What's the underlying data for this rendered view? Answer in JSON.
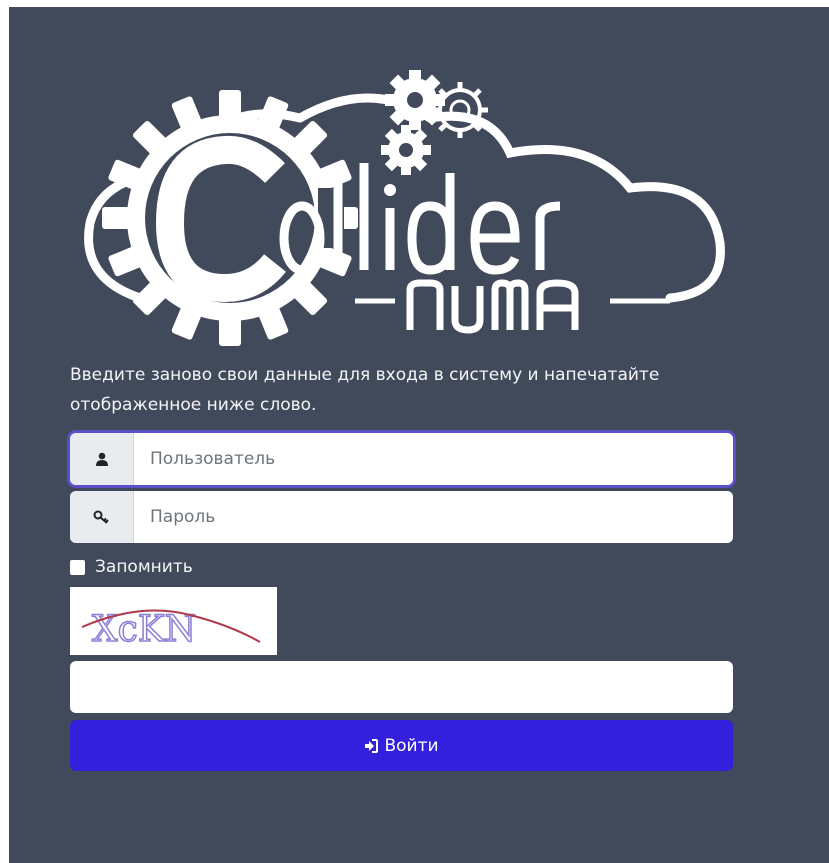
{
  "logo": {
    "brand_text": "Collider",
    "sub_text": "NUMA"
  },
  "intro": {
    "text": "Введите заново свои данные для входа в систему и напечатайте отображенное ниже слово."
  },
  "form": {
    "username": {
      "icon": "user-icon",
      "placeholder": "Пользователь",
      "value": ""
    },
    "password": {
      "icon": "key-icon",
      "placeholder": "Пароль",
      "value": ""
    },
    "remember": {
      "label": "Запомнить",
      "checked": false
    },
    "captcha": {
      "text": "XcKN",
      "input_value": ""
    },
    "submit": {
      "icon": "sign-in-icon",
      "label": "Войти"
    }
  },
  "colors": {
    "background": "#414a5b",
    "accent_button": "#3220dc",
    "focus_ring": "#5b4fc7",
    "logo": "#ffffff"
  }
}
